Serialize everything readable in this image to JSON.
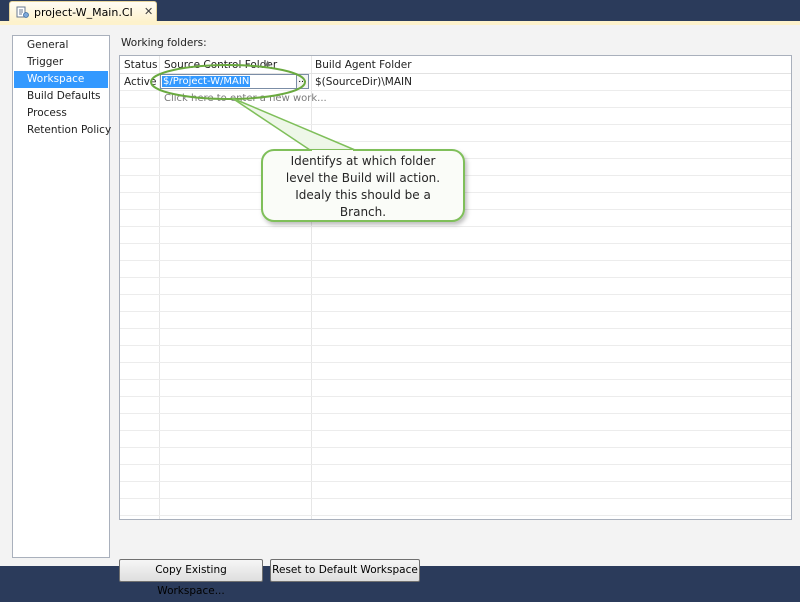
{
  "tab": {
    "title": "project-W_Main.CI",
    "close": "✕",
    "icon": "document-icon"
  },
  "nav": {
    "items": [
      {
        "label": "General",
        "selected": false
      },
      {
        "label": "Trigger",
        "selected": false
      },
      {
        "label": "Workspace",
        "selected": true
      },
      {
        "label": "Build Defaults",
        "selected": false
      },
      {
        "label": "Process",
        "selected": false
      },
      {
        "label": "Retention Policy",
        "selected": false
      }
    ]
  },
  "workspace": {
    "heading": "Working folders:",
    "columns": {
      "status": "Status",
      "source": "Source Control Folder",
      "sort_indicator": "▲",
      "agent": "Build Agent Folder"
    },
    "row": {
      "status": "Active",
      "source_value": "$/Project-W/MAIN",
      "browse_label": "...",
      "agent": "$(SourceDir)\\MAIN"
    },
    "new_row_placeholder": "Click here to enter a new work..."
  },
  "buttons": {
    "copy": "Copy Existing Workspace...",
    "reset": "Reset to Default Workspace"
  },
  "callout": {
    "lines": [
      "Identifys at which folder",
      "level the Build will action.",
      "Idealy this should be a",
      "Branch."
    ],
    "color": "#5fb446"
  }
}
